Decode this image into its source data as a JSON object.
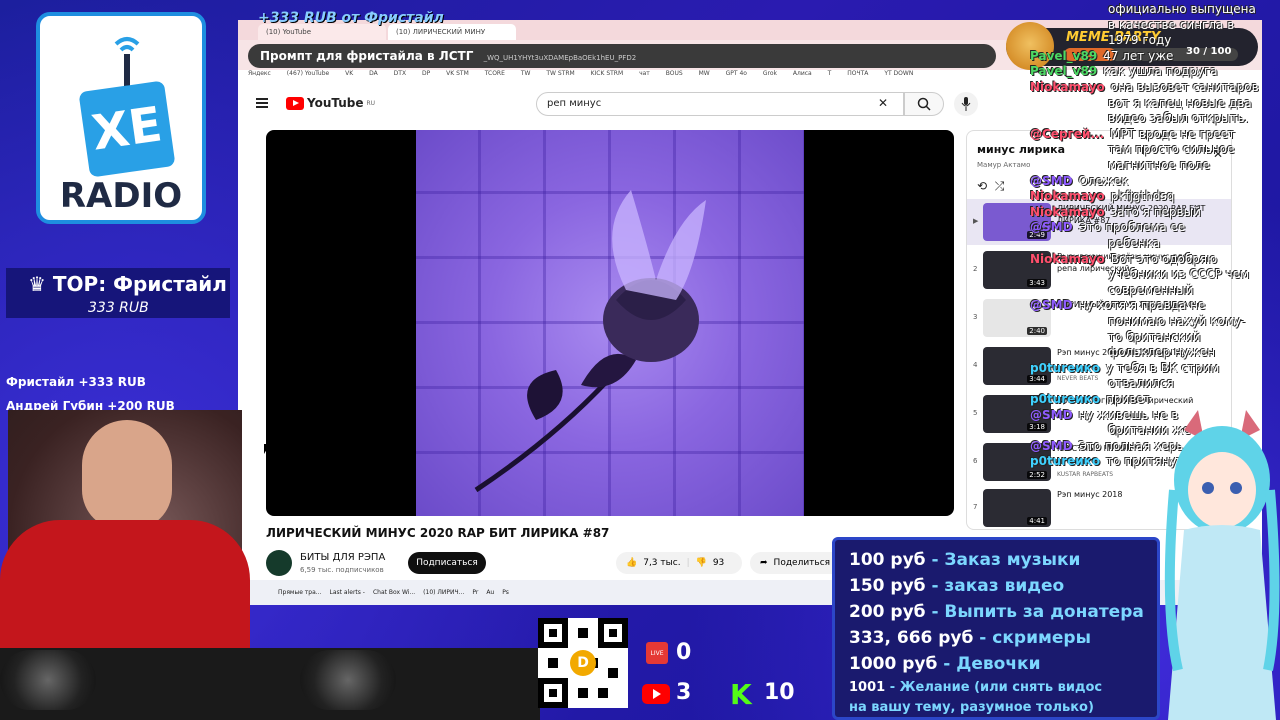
{
  "overlay": {
    "top_alert": "+333 RUB  от Фристайл",
    "logo_text": "RADIO",
    "logo_badge": "XE",
    "top_title": "TOP: Фристайл",
    "top_amount": "333 RUB",
    "recent": [
      "Фристайл +333 RUB",
      "Андрей Губин +200 RUB"
    ],
    "meme_title": "MEME PARTY",
    "meme_count": "30 / 100",
    "meme_progress": 0.3
  },
  "browser": {
    "tabs": [
      "(10) YouTube",
      "(10) ЛИРИЧЕСКИЙ МИНУ"
    ],
    "prompt": "Промпт для фристайла в ЛСТГ",
    "prompt_url": "_WQ_UH1YHYt3uXDAMEpBaOEk1hEU_PFD2",
    "bookmarks": [
      "Яндекс",
      "(467) YouTube",
      "VK",
      "DA",
      "DTX",
      "DP",
      "VK STM",
      "TCORE",
      "TW",
      "TW STRM",
      "KICK STRM",
      "чат",
      "BOUS",
      "MW",
      "GPT 4o",
      "Grok",
      "Алиса",
      "T",
      "ПОЧТА",
      "YT DOWN"
    ]
  },
  "youtube": {
    "logo": "YouTube",
    "region": "RU",
    "search_value": "реп минус",
    "video_title": "ЛИРИЧЕСКИЙ МИНУС 2020 RAP БИТ ЛИРИКА #87",
    "channel_name": "БИТЫ ДЛЯ РЭПА",
    "channel_subs": "6,59 тыс. подписчиков",
    "subscribe": "Подписаться",
    "likes": "7,3 тыс.",
    "dislikes": "93",
    "share": "Поделиться"
  },
  "playlist": {
    "title": "минус лирика",
    "owner": "Мамур Актамо",
    "items": [
      {
        "idx": "",
        "name": "ЛИРИЧЕСКИЙ МИНУС 2020 RAP БИТ ЛИРИКА #87",
        "duration": "2:49",
        "channel": ""
      },
      {
        "idx": "2",
        "name": "Вызывающий слёзы минус для репа лирический",
        "duration": "3:43",
        "channel": ""
      },
      {
        "idx": "3",
        "name": "ЛИРИЧНЫЙ МИНУС ХСНО МАСАО",
        "duration": "2:40",
        "channel": ""
      },
      {
        "idx": "4",
        "name": "Рэп минус 2019 INSTRUMENTAL",
        "duration": "3:44",
        "channel": "NEVER BEATS"
      },
      {
        "idx": "5",
        "name": "Красивый грустный лирический бит",
        "duration": "3:18",
        "channel": ""
      },
      {
        "idx": "6",
        "name": "ГРУСТНЫЙ МИНУС",
        "duration": "2:52",
        "channel": "KUSTAR RAPBEATS"
      },
      {
        "idx": "7",
        "name": "Рэп минус 2018",
        "duration": "4:41",
        "channel": ""
      }
    ]
  },
  "taskbar": [
    "Прямые тра...",
    "Last alerts -",
    "Chat Box Wi...",
    "(10) ЛИРИЧ...",
    "Pr",
    "Au",
    "Ps"
  ],
  "chat": [
    {
      "nick": "",
      "text": "официально выпущена"
    },
    {
      "nick": "",
      "text": "в качестве сингла в"
    },
    {
      "nick": "",
      "text": "1979 году"
    },
    {
      "nick": "Pavel_v89",
      "text": "47 лет уже"
    },
    {
      "nick": "Pavel_v89",
      "text": "как ушла подруга"
    },
    {
      "nick": "Niokamayo",
      "text": "она вызовет санитаров"
    },
    {
      "nick": "",
      "text": "вот я капец новые два"
    },
    {
      "nick": "",
      "text": "видео забыл открыть."
    },
    {
      "nick": "@Сергей...",
      "text": "МРТ вроде не греет"
    },
    {
      "nick": "",
      "text": "там просто сильное"
    },
    {
      "nick": "",
      "text": "магнитное поле"
    },
    {
      "nick": "@SMD",
      "text": "Олежек"
    },
    {
      "nick": "Niokamayo",
      "text": "pkfjgthdsq"
    },
    {
      "nick": "Niokamayo",
      "text": "зато я первый"
    },
    {
      "nick": "@SMD",
      "text": "Это проблема ее"
    },
    {
      "nick": "",
      "text": "ребенка"
    },
    {
      "nick": "Niokamayo",
      "text": "Вот это одобряю"
    },
    {
      "nick": "",
      "text": "учебники из СССР чем"
    },
    {
      "nick": "",
      "text": "современный"
    },
    {
      "nick": "@SMD",
      "text": "ну хотя я правда не"
    },
    {
      "nick": "",
      "text": "понимаю нахуй кому-"
    },
    {
      "nick": "",
      "text": "то британский"
    },
    {
      "nick": "",
      "text": "фольклер нужен"
    },
    {
      "nick": "p0tureико",
      "text": "у тебя в ВК стрим"
    },
    {
      "nick": "",
      "text": "отвалился"
    },
    {
      "nick": "p0tureико",
      "text": "привет"
    },
    {
      "nick": "@SMD",
      "text": "ну живешь не в"
    },
    {
      "nick": "",
      "text": "британии же"
    },
    {
      "nick": "@SMD",
      "text": "Это полная херь. За"
    },
    {
      "nick": "p0tureико",
      "text": "то притянуто"
    }
  ],
  "stats": {
    "live": "0",
    "youtube": "3",
    "kick": "10",
    "live_label": "LIVE"
  },
  "prices": [
    {
      "amount": "100 руб",
      "text": " - Заказ музыки"
    },
    {
      "amount": "150 руб",
      "text": " - заказ видео"
    },
    {
      "amount": "200 руб",
      "text": " - Выпить за донатера"
    },
    {
      "amount": "333, 666 руб",
      "text": " - скримеры"
    },
    {
      "amount": "1000 руб",
      "text": " - Девочки"
    },
    {
      "amount": "1001",
      "text": " - Желание (или снять видос"
    },
    {
      "amount": "",
      "text": "на вашу тему, разумное только)"
    }
  ]
}
